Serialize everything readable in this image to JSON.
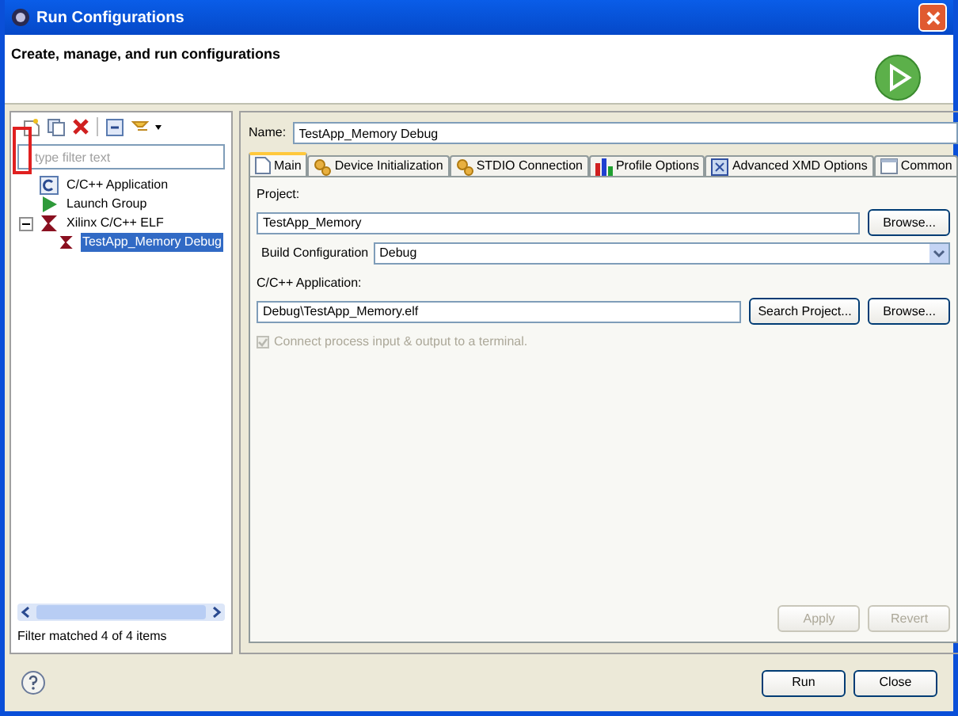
{
  "window": {
    "title": "Run Configurations"
  },
  "header": {
    "title": "Create, manage, and run configurations"
  },
  "filter": {
    "placeholder": "type filter text"
  },
  "tree": [
    {
      "label": "C/C++ Application",
      "kind": "c-app",
      "selected": false
    },
    {
      "label": "Launch Group",
      "kind": "launch",
      "selected": false
    },
    {
      "label": "Xilinx C/C++ ELF",
      "kind": "xilinx",
      "selected": false,
      "expanded": true,
      "children": [
        {
          "label": "TestApp_Memory Debug",
          "kind": "xilinx",
          "selected": true
        }
      ]
    }
  ],
  "filter_status": "Filter matched 4 of 4 items",
  "name": {
    "label": "Name:",
    "value": "TestApp_Memory Debug"
  },
  "tabs": [
    {
      "label": "Main",
      "kind": "doc",
      "selected": true
    },
    {
      "label": "Device Initialization",
      "kind": "gear",
      "selected": false
    },
    {
      "label": "STDIO Connection",
      "kind": "gear",
      "selected": false
    },
    {
      "label": "Profile Options",
      "kind": "bars",
      "selected": false
    },
    {
      "label": "Advanced XMD Options",
      "kind": "xmd",
      "selected": false
    },
    {
      "label": "Common",
      "kind": "window",
      "selected": false
    }
  ],
  "project": {
    "label": "Project:",
    "value": "TestApp_Memory",
    "button": "Browse..."
  },
  "build": {
    "label": "Build Configuration",
    "value": "Debug"
  },
  "app": {
    "label": "C/C++ Application:",
    "value": "Debug\\TestApp_Memory.elf",
    "search_button": "Search Project...",
    "browse_button": "Browse..."
  },
  "connect": {
    "label": "Connect process input & output to a terminal.",
    "checked": true,
    "disabled": true
  },
  "apply_buttons": [
    {
      "label": "Apply",
      "disabled": true
    },
    {
      "label": "Revert",
      "disabled": true
    }
  ],
  "dialog_buttons": [
    {
      "label": "Run"
    },
    {
      "label": "Close"
    }
  ]
}
